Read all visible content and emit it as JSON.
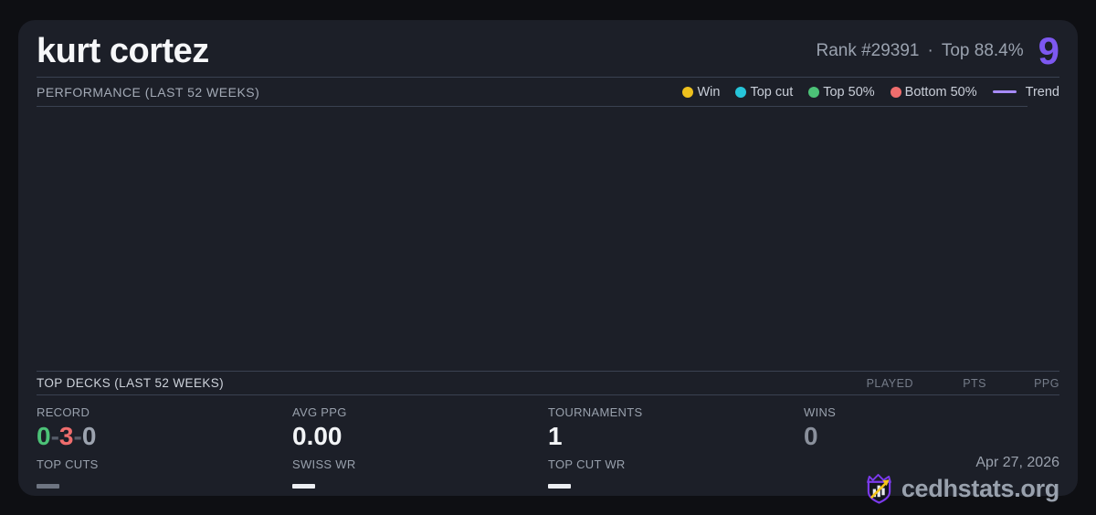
{
  "page": {
    "background": "#0e0f13",
    "card_background": "#1c1f28"
  },
  "card": {
    "title": "kurt cortez",
    "rank": "Rank #29391",
    "separator": "·",
    "percentile": "Top 88.4%",
    "score_badge": "9",
    "accent_purple": "#7d58f0"
  },
  "performance": {
    "heading": "PERFORMANCE (LAST 52 WEEKS)",
    "legend": {
      "items": [
        {
          "label": "Win",
          "color": "#edc01d"
        },
        {
          "label": "Top cut",
          "color": "#26c5da"
        },
        {
          "label": "Top 50%",
          "color": "#4cc277"
        },
        {
          "label": "Bottom 50%",
          "color": "#ef6d6d"
        }
      ],
      "trend": {
        "label": "Trend",
        "color": "#a78bfa"
      }
    }
  },
  "top_decks": {
    "heading": "TOP DECKS (LAST 52 WEEKS)",
    "columns": [
      "PLAYED",
      "PTS",
      "PPG"
    ]
  },
  "stats": {
    "record": {
      "label": "RECORD",
      "wins": "0",
      "losses": "3",
      "draws": "0",
      "separator": "-",
      "win_color": "#4cc277",
      "loss_color": "#ef6d6d",
      "draw_color": "#9ca3af"
    },
    "avg_ppg": {
      "label": "AVG PPG",
      "value": "0.00",
      "color": "#f2f4f6"
    },
    "tournaments": {
      "label": "TOURNAMENTS",
      "value": "1",
      "color": "#f2f4f6"
    },
    "wins": {
      "label": "WINS",
      "value": "0",
      "color": "#8a909c"
    },
    "top_cuts": {
      "label": "TOP CUTS",
      "dash_color": "#6e7582"
    },
    "swiss_wr": {
      "label": "SWISS WR",
      "dash_color": "#eceef2"
    },
    "top_cut_wr": {
      "label": "TOP CUT WR",
      "dash_color": "#eceef2"
    }
  },
  "footer": {
    "date": "Apr 27, 2026",
    "brand": "cedhstats.org",
    "logo_purple": "#7c3aed",
    "logo_gold": "#f5c518"
  }
}
